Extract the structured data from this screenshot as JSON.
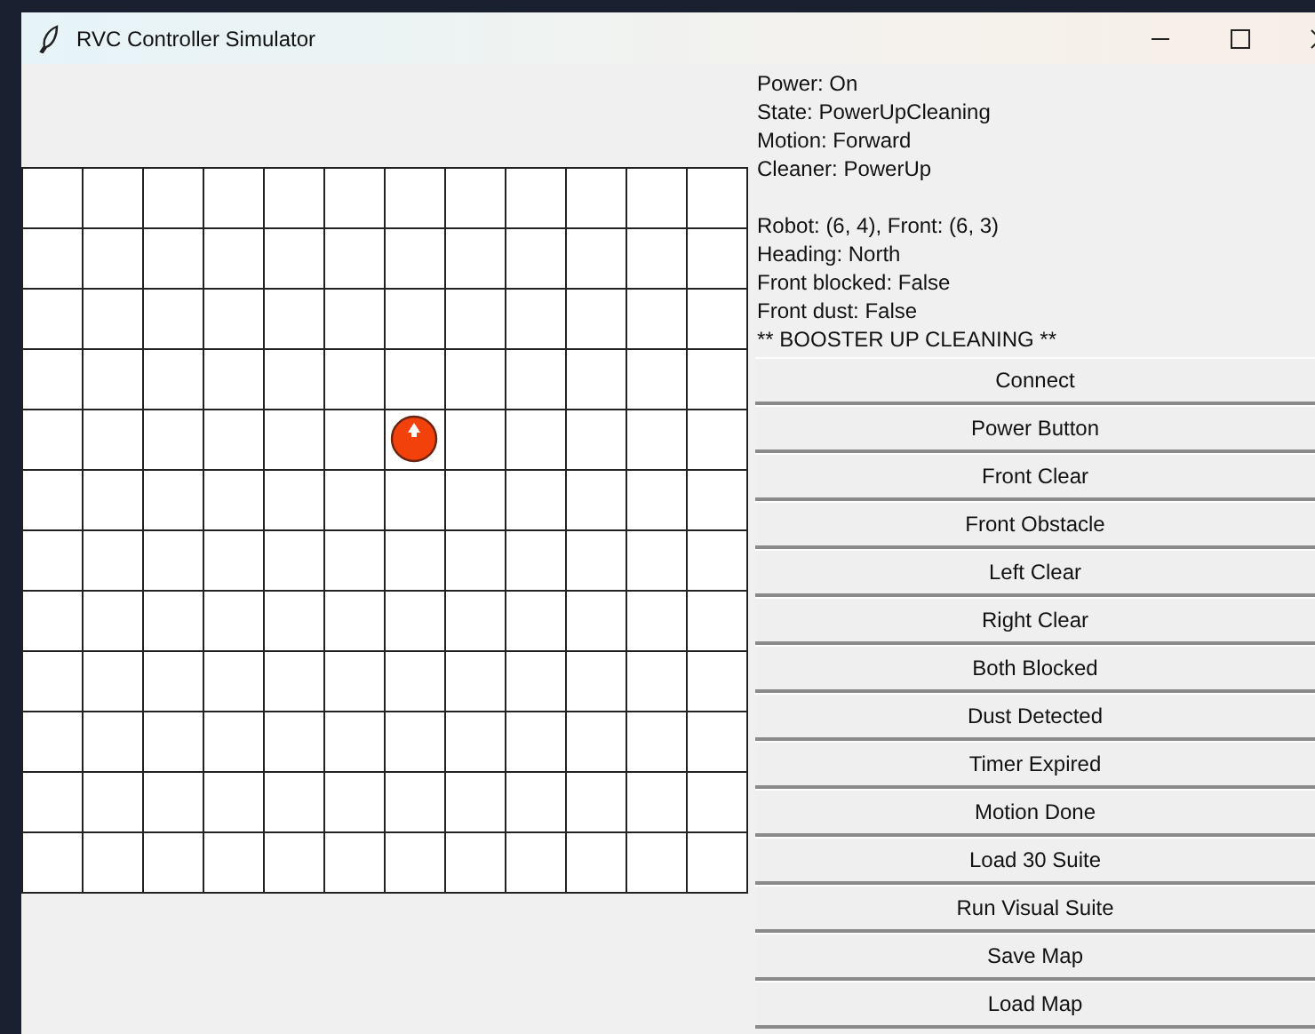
{
  "window": {
    "title": "RVC Controller Simulator"
  },
  "status_lines": [
    "Power: On",
    "State: PowerUpCleaning",
    "Motion: Forward",
    "Cleaner: PowerUp"
  ],
  "position_lines": [
    "Robot: (6, 4), Front: (6, 3)",
    "Heading: North",
    "Front blocked: False",
    "Front dust: False",
    "** BOOSTER UP CLEANING **"
  ],
  "buttons": [
    "Connect",
    "Power Button",
    "Front Clear",
    "Front Obstacle",
    "Left Clear",
    "Right Clear",
    "Both Blocked",
    "Dust Detected",
    "Timer Expired",
    "Motion Done",
    "Load 30 Suite",
    "Run Visual Suite",
    "Save Map",
    "Load Map"
  ]
}
